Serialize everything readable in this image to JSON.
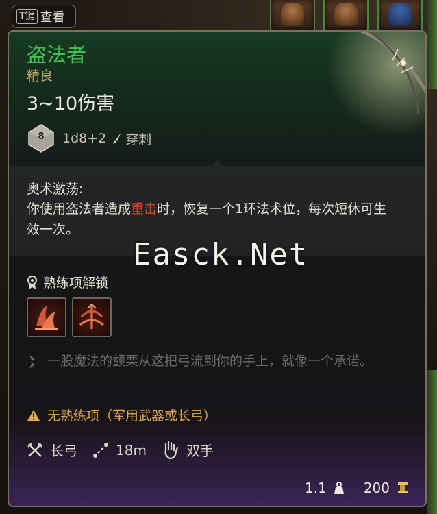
{
  "key_hint": {
    "key": "T键",
    "label": "查看"
  },
  "item": {
    "name": "盗法者",
    "rarity": "精良",
    "damage": "3~10伤害",
    "die_face": "8",
    "dice_formula": "1d8+2",
    "damage_type": "穿刺"
  },
  "passive": {
    "title": "奥术激荡:",
    "text_before": "你使用盗法者造成",
    "text_highlight": "重击",
    "text_after": "时，恢复一个1环法术位，每次短休可生效一次。"
  },
  "proficiency_unlock": {
    "label": "熟练项解锁"
  },
  "flavor_text": "一股魔法的颤栗从这把弓流到你的手上，就像一个承诺。",
  "warning": {
    "text": "无熟练项（军用武器或长弓）"
  },
  "properties": {
    "weapon_type": "长弓",
    "range": "18m",
    "handedness": "双手"
  },
  "footer": {
    "weight": "1.1",
    "value": "200"
  },
  "watermark": "Easck.Net",
  "colors": {
    "item_name": "#3fc251",
    "rarity": "#c2a76a",
    "crit_highlight": "#d9432e",
    "warning": "#e2a94a",
    "flavor": "#6d6a66"
  },
  "icons": {
    "dice": "d8-die-icon",
    "damage_type": "piercing-icon",
    "unlock": "proficiency-unlock-icon",
    "actions": [
      "action-icon-1",
      "action-icon-2"
    ],
    "flavor": "feather-icon",
    "warning": "warning-triangle-icon",
    "weapon_type": "crossed-weapons-icon",
    "range": "range-icon",
    "handedness": "two-handed-icon",
    "weight": "weight-icon",
    "value": "gold-icon"
  }
}
